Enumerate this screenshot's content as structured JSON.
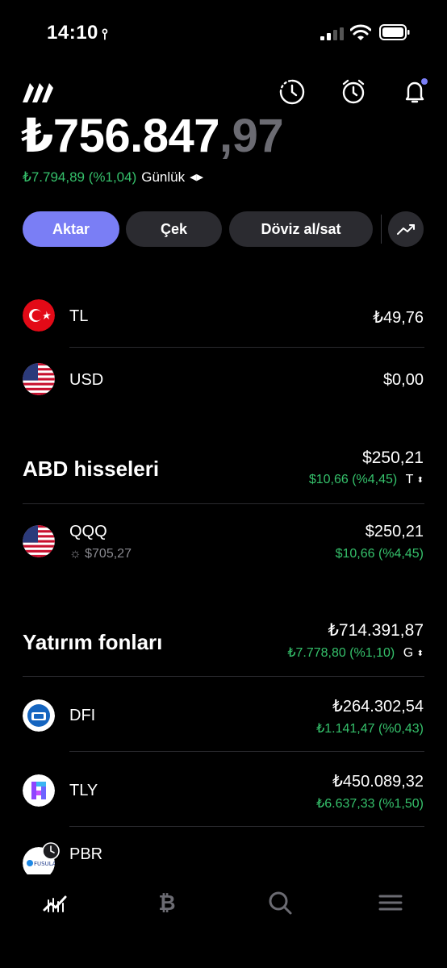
{
  "status_bar": {
    "time": "14:10"
  },
  "header": {
    "balance_main": "₺756.847",
    "balance_decimals": ",97",
    "daily_change": "₺7.794,89 (%1,04)",
    "daily_period": "Günlük"
  },
  "actions": {
    "transfer": "Aktar",
    "withdraw": "Çek",
    "fx": "Döviz al/sat"
  },
  "cash": [
    {
      "label": "TL",
      "value": "₺49,76"
    },
    {
      "label": "USD",
      "value": "$0,00"
    }
  ],
  "us_stocks": {
    "title": "ABD hisseleri",
    "value": "$250,21",
    "change": "$10,66 (%4,45)",
    "mode": "T",
    "items": [
      {
        "ticker": "QQQ",
        "price": "$705,27",
        "value": "$250,21",
        "change": "$10,66 (%4,45)"
      }
    ]
  },
  "funds": {
    "title": "Yatırım fonları",
    "value": "₺714.391,87",
    "change": "₺7.778,80 (%1,10)",
    "mode": "G",
    "items": [
      {
        "ticker": "DFI",
        "value": "₺264.302,54",
        "change": "₺1.141,47 (%0,43)"
      },
      {
        "ticker": "TLY",
        "value": "₺450.089,32",
        "change": "₺6.637,33 (%1,50)"
      },
      {
        "ticker": "PBR",
        "logo_text": "FUSULA"
      }
    ]
  },
  "icons": [
    "location-arrow-icon",
    "signal-icon",
    "wifi-icon",
    "battery-icon",
    "brand-logo",
    "history-icon",
    "alarm-icon",
    "bell-icon",
    "trend-icon",
    "sun-icon",
    "portfolio-tab-icon",
    "bitcoin-tab-icon",
    "search-tab-icon",
    "menu-tab-icon"
  ],
  "colors": {
    "accent": "#7a7ef5",
    "positive": "#35c16b",
    "background": "#000000",
    "button": "#2b2b30",
    "notification_dot": "#7a7ef5"
  }
}
